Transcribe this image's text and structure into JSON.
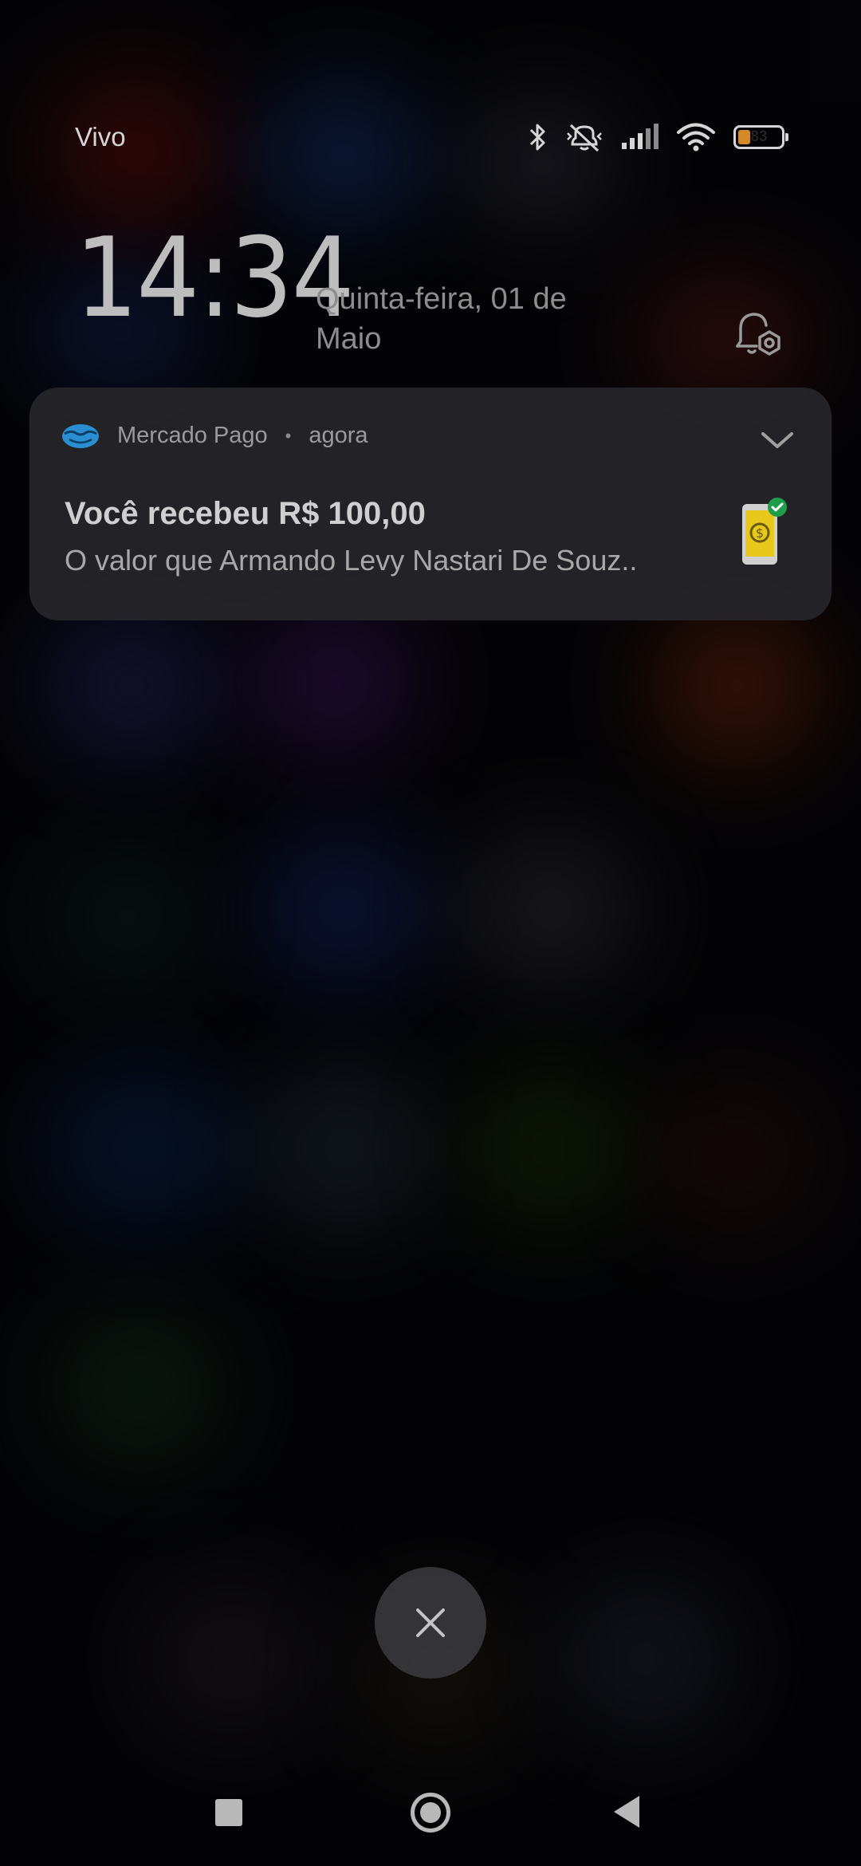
{
  "status_bar": {
    "carrier": "Vivo",
    "battery_level": "83",
    "icons": [
      "bluetooth-icon",
      "vibrate-off-icon",
      "signal-icon",
      "wifi-icon",
      "battery-icon"
    ]
  },
  "lock_screen": {
    "time": "14:34",
    "date": "Quinta-feira, 01 de Maio"
  },
  "notification": {
    "app_name": "Mercado Pago",
    "separator": "•",
    "time": "agora",
    "title": "Você recebeu R$ 100,00",
    "body": "O valor que Armando Levy Nastari De Souz..",
    "image_icon": "phone-money-approved-icon"
  },
  "colors": {
    "app_logo": "#2a8fd0",
    "approved_badge": "#1e9e4a",
    "phone_screen": "#e8c81a",
    "battery_fill": "#d58a2a"
  },
  "navigation": {
    "icons": [
      "recents-icon",
      "home-icon",
      "back-icon"
    ]
  }
}
